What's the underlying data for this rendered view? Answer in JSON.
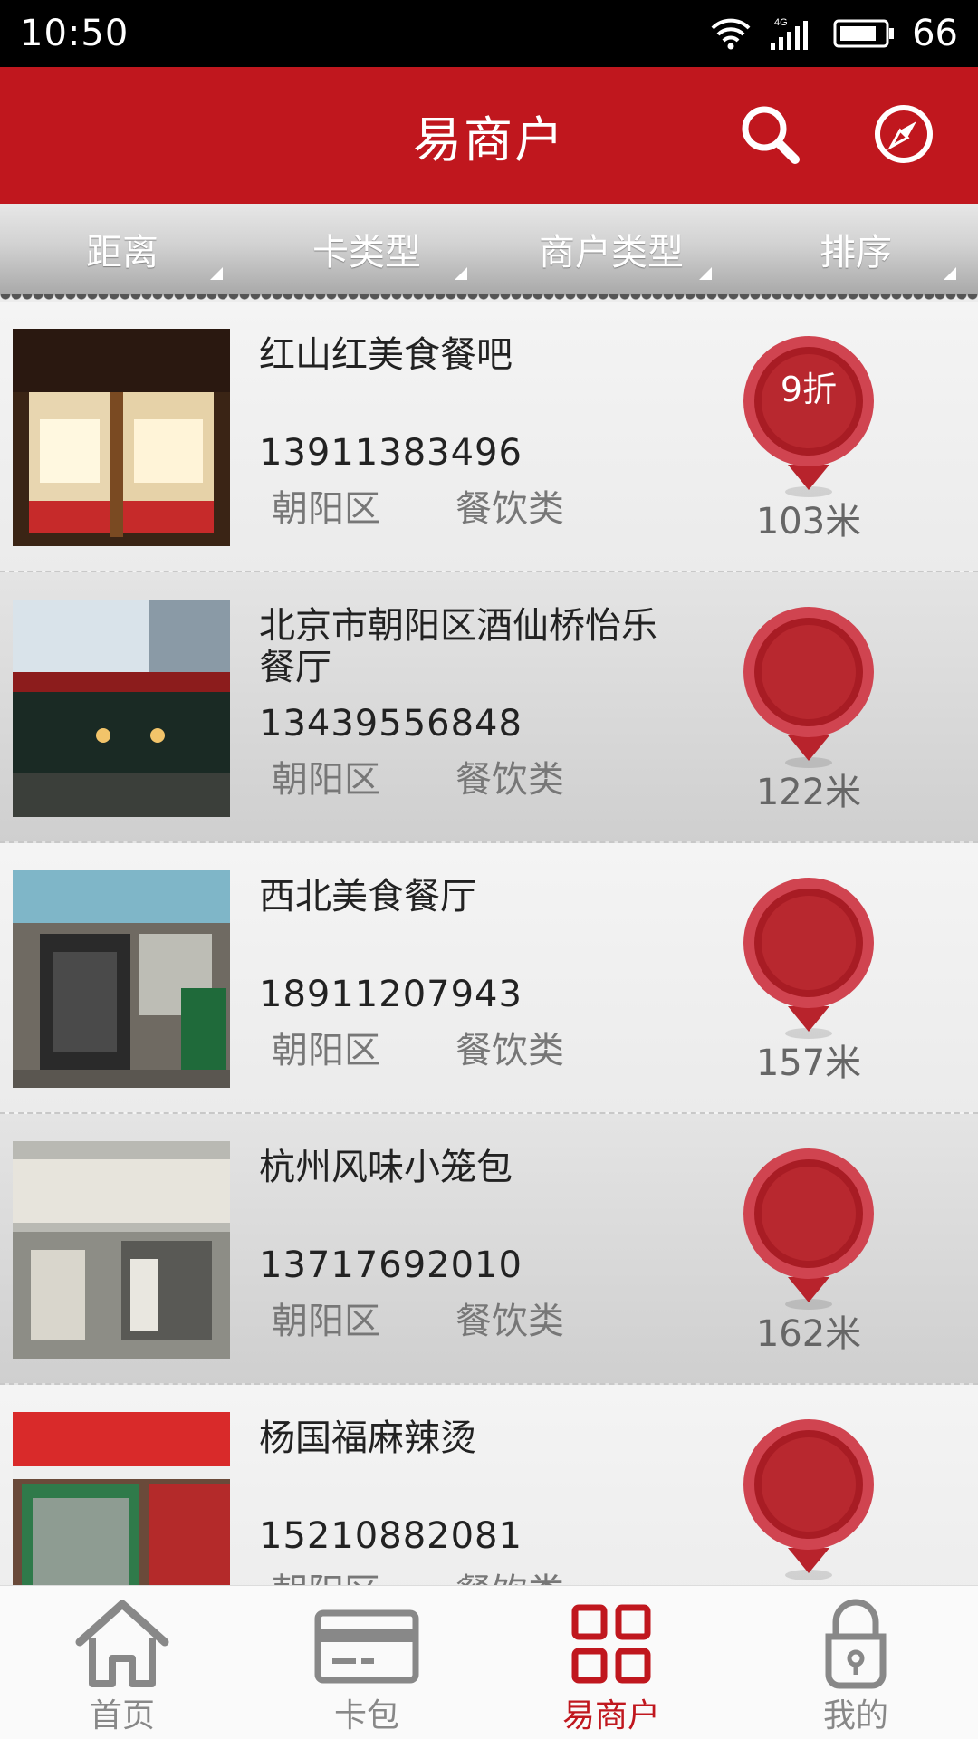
{
  "status_bar": {
    "time": "10:50",
    "network": "4G",
    "battery": "66"
  },
  "header": {
    "title": "易商户",
    "search_icon": "search-icon",
    "compass_icon": "compass-icon"
  },
  "filters": [
    {
      "label": "距离"
    },
    {
      "label": "卡类型"
    },
    {
      "label": "商户类型"
    },
    {
      "label": "排序"
    }
  ],
  "merchants": [
    {
      "name": "红山红美食餐吧",
      "phone": "13911383496",
      "district": "朝阳区",
      "category": "餐饮类",
      "discount": "9折",
      "distance": "103米"
    },
    {
      "name": "北京市朝阳区酒仙桥怡乐餐厅",
      "phone": "13439556848",
      "district": "朝阳区",
      "category": "餐饮类",
      "discount": "",
      "distance": "122米"
    },
    {
      "name": "西北美食餐厅",
      "phone": "18911207943",
      "district": "朝阳区",
      "category": "餐饮类",
      "discount": "",
      "distance": "157米"
    },
    {
      "name": "杭州风味小笼包",
      "phone": "13717692010",
      "district": "朝阳区",
      "category": "餐饮类",
      "discount": "",
      "distance": "162米"
    },
    {
      "name": "杨国福麻辣烫",
      "phone": "15210882081",
      "district": "朝阳区",
      "category": "餐饮类",
      "discount": "",
      "distance": ""
    }
  ],
  "tabs": [
    {
      "label": "首页",
      "icon": "home-icon"
    },
    {
      "label": "卡包",
      "icon": "card-icon"
    },
    {
      "label": "易商户",
      "icon": "grid-icon"
    },
    {
      "label": "我的",
      "icon": "lock-icon"
    }
  ],
  "colors": {
    "brand_red": "#c0171e",
    "pin_red": "#b8232c",
    "tab_inactive": "#888888"
  }
}
